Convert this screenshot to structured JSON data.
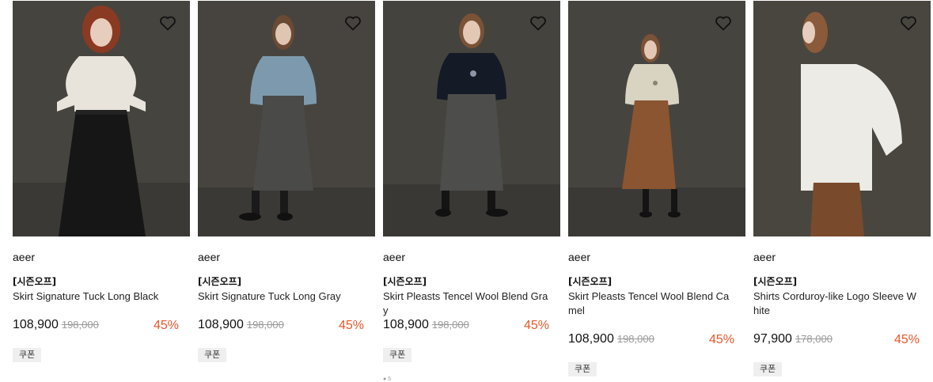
{
  "products": [
    {
      "brand": "aeer",
      "tag": "[시즌오프]",
      "name": "Skirt Signature Tuck Long Black",
      "price": "108,900",
      "original_price": "198,000",
      "discount": "45%",
      "coupon": "쿠폰",
      "wishlist_icon": "heart-outline-icon",
      "photo": {
        "top_color": "#e8e4dc",
        "bottom_color": "#161616",
        "hair_color": "#8a3a22"
      }
    },
    {
      "brand": "aeer",
      "tag": "[시즌오프]",
      "name": "Skirt Signature Tuck Long Gray",
      "price": "108,900",
      "original_price": "198,000",
      "discount": "45%",
      "coupon": "쿠폰",
      "wishlist_icon": "heart-outline-icon",
      "photo": {
        "top_color": "#7d99ad",
        "bottom_color": "#4a4a48",
        "hair_color": "#6b4a34"
      }
    },
    {
      "brand": "aeer",
      "tag": "[시즌오프]",
      "name": "Skirt Pleasts Tencel Wool Blend Gray",
      "price": "108,900",
      "original_price": "198,000",
      "discount": "45%",
      "coupon": "쿠폰",
      "wishlist_icon": "heart-outline-icon",
      "photo": {
        "top_color": "#141a26",
        "bottom_color": "#4d4d4b",
        "hair_color": "#7a5236"
      }
    },
    {
      "brand": "aeer",
      "tag": "[시즌오프]",
      "name": "Skirt Pleasts Tencel Wool Blend Camel",
      "price": "108,900",
      "original_price": "198,000",
      "discount": "45%",
      "coupon": "쿠폰",
      "wishlist_icon": "heart-outline-icon",
      "photo": {
        "top_color": "#d9d3c2",
        "bottom_color": "#8a5530",
        "hair_color": "#7a5236"
      }
    },
    {
      "brand": "aeer",
      "tag": "[시즌오프]",
      "name": "Shirts Corduroy-like Logo Sleeve White",
      "price": "97,900",
      "original_price": "178,000",
      "discount": "45%",
      "coupon": "쿠폰",
      "wishlist_icon": "heart-outline-icon",
      "photo": {
        "top_color": "#ecebe6",
        "bottom_color": "#7a4a2c",
        "hair_color": "#8a5a3a"
      }
    }
  ],
  "colors": {
    "discount": "#e8572a",
    "price": "#111111",
    "original_price": "#9a9a9a"
  },
  "footer_hint": "● 5"
}
